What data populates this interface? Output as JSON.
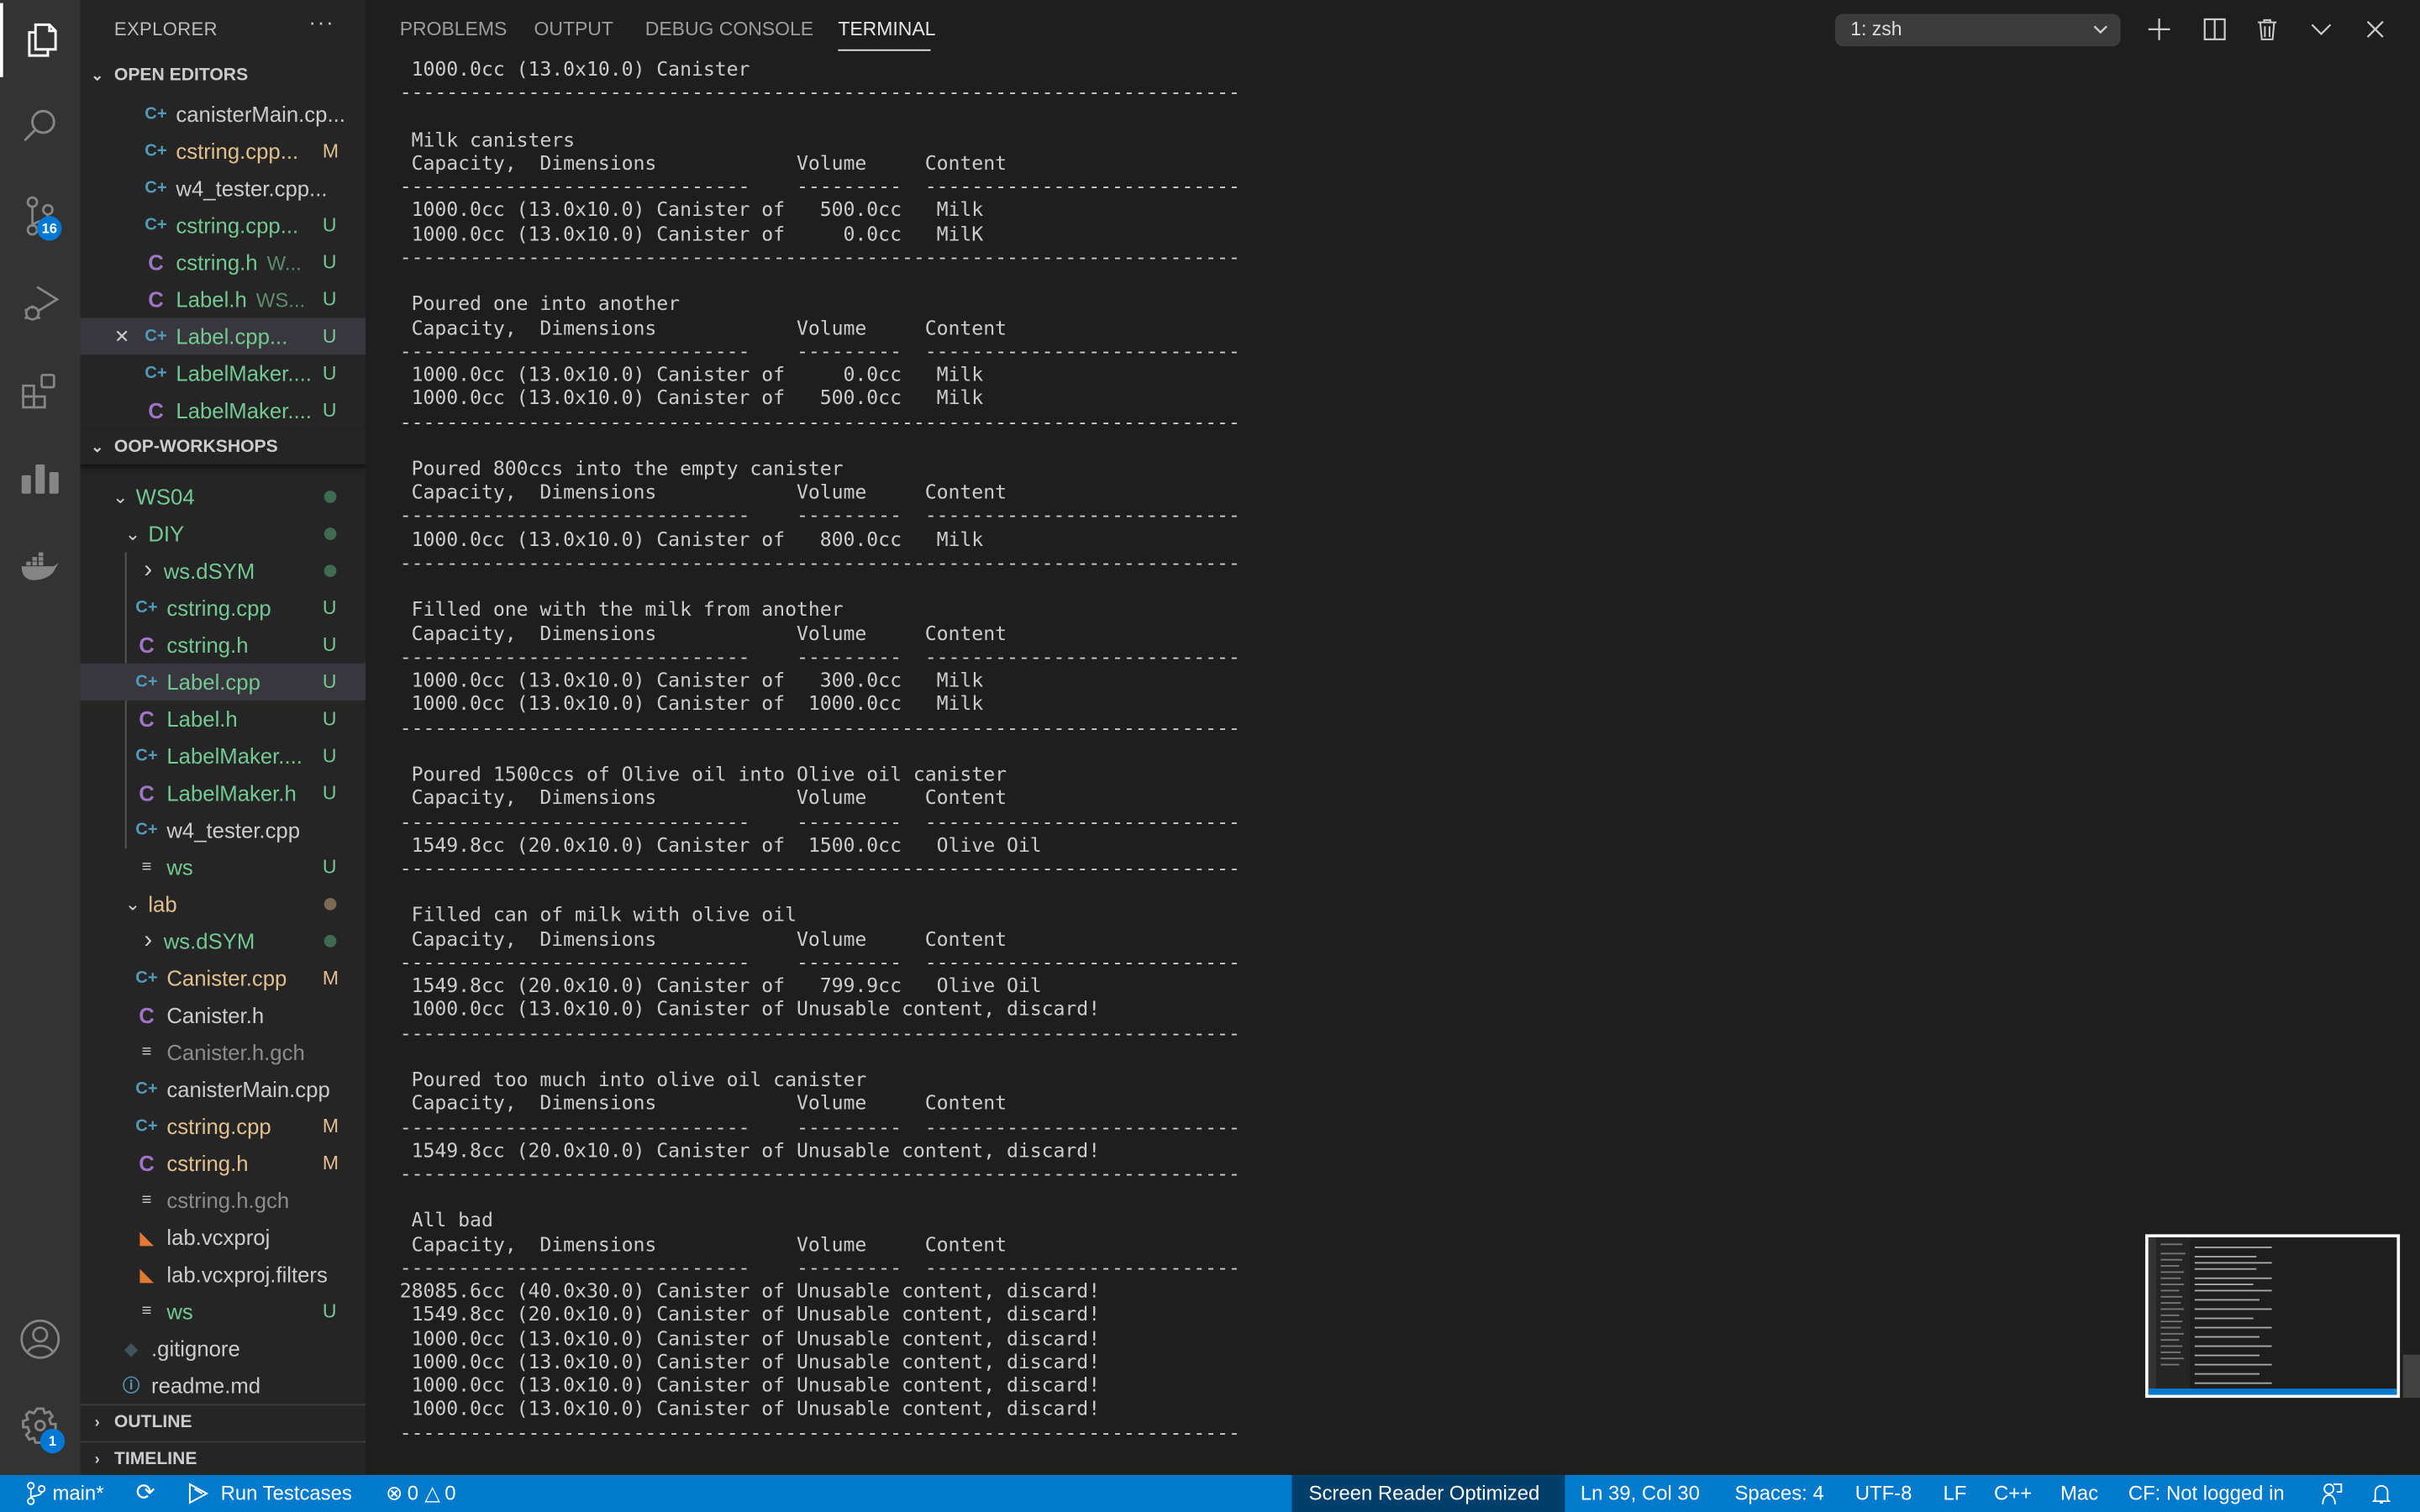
{
  "activity_bar": {
    "items": [
      {
        "name": "explorer",
        "icon": "files-icon",
        "active": true
      },
      {
        "name": "search",
        "icon": "search-icon"
      },
      {
        "name": "source-control",
        "icon": "source-control-icon",
        "badge": "16"
      },
      {
        "name": "run-debug",
        "icon": "run-debug-icon"
      },
      {
        "name": "extensions",
        "icon": "extensions-icon"
      },
      {
        "name": "analytics",
        "icon": "bar-chart-icon"
      },
      {
        "name": "docker",
        "icon": "docker-icon"
      }
    ],
    "bottom": [
      {
        "name": "accounts",
        "icon": "account-icon"
      },
      {
        "name": "manage",
        "icon": "gear-icon",
        "badge": "1"
      }
    ]
  },
  "sidebar": {
    "title": "EXPLORER",
    "more": "···",
    "open_editors": {
      "label": "OPEN EDITORS",
      "items": [
        {
          "name": "canisterMain.cp...",
          "icon": "cpp",
          "color": "white"
        },
        {
          "name": "cstring.cpp...",
          "icon": "cpp",
          "color": "yellow",
          "badge": "M"
        },
        {
          "name": "w4_tester.cpp...",
          "icon": "cpp",
          "color": "white"
        },
        {
          "name": "cstring.cpp...",
          "icon": "cpp",
          "color": "green",
          "badge": "U"
        },
        {
          "name": "cstring.h",
          "desc": "W...",
          "icon": "c",
          "color": "green",
          "badge": "U"
        },
        {
          "name": "Label.h",
          "desc": "WS...",
          "icon": "c",
          "color": "green",
          "badge": "U"
        },
        {
          "name": "Label.cpp...",
          "icon": "cpp",
          "color": "green",
          "badge": "U",
          "selected": true,
          "close": true
        },
        {
          "name": "LabelMaker....",
          "icon": "cpp",
          "color": "green",
          "badge": "U"
        },
        {
          "name": "LabelMaker....",
          "icon": "c",
          "color": "green",
          "badge": "U"
        }
      ]
    },
    "workspace": {
      "label": "OOP-WORKSHOPS",
      "items": [
        {
          "name": "WS04",
          "folder": true,
          "open": true,
          "level": 1,
          "color": "green",
          "dot": "#3f6b52"
        },
        {
          "name": "DIY",
          "folder": true,
          "open": true,
          "level": 2,
          "color": "green",
          "dot": "#3f6b52"
        },
        {
          "name": "ws.dSYM",
          "folder": true,
          "open": false,
          "level": 3,
          "color": "green",
          "dot": "#3f6b52"
        },
        {
          "name": "cstring.cpp",
          "icon": "cpp",
          "level": 3,
          "color": "green",
          "badge": "U"
        },
        {
          "name": "cstring.h",
          "icon": "c",
          "level": 3,
          "color": "green",
          "badge": "U"
        },
        {
          "name": "Label.cpp",
          "icon": "cpp",
          "level": 3,
          "color": "green",
          "badge": "U",
          "selected": true
        },
        {
          "name": "Label.h",
          "icon": "c",
          "level": 3,
          "color": "green",
          "badge": "U"
        },
        {
          "name": "LabelMaker....",
          "icon": "cpp",
          "level": 3,
          "color": "green",
          "badge": "U"
        },
        {
          "name": "LabelMaker.h",
          "icon": "c",
          "level": 3,
          "color": "green",
          "badge": "U"
        },
        {
          "name": "w4_tester.cpp",
          "icon": "cpp",
          "level": 3,
          "color": "white"
        },
        {
          "name": "ws",
          "icon": "txt",
          "level": 3,
          "color": "green",
          "badge": "U"
        },
        {
          "name": "lab",
          "folder": true,
          "open": true,
          "level": 2,
          "color": "yellow",
          "dot": "#7a6a52"
        },
        {
          "name": "ws.dSYM",
          "folder": true,
          "open": false,
          "level": 3,
          "color": "green",
          "dot": "#3f6b52"
        },
        {
          "name": "Canister.cpp",
          "icon": "cpp",
          "level": 3,
          "color": "yellow",
          "badge": "M"
        },
        {
          "name": "Canister.h",
          "icon": "c",
          "level": 3,
          "color": "white"
        },
        {
          "name": "Canister.h.gch",
          "icon": "txt",
          "level": 3,
          "color": "gray"
        },
        {
          "name": "canisterMain.cpp",
          "icon": "cpp",
          "level": 3,
          "color": "white"
        },
        {
          "name": "cstring.cpp",
          "icon": "cpp",
          "level": 3,
          "color": "yellow",
          "badge": "M"
        },
        {
          "name": "cstring.h",
          "icon": "c",
          "level": 3,
          "color": "yellow",
          "badge": "M"
        },
        {
          "name": "cstring.h.gch",
          "icon": "txt",
          "level": 3,
          "color": "gray"
        },
        {
          "name": "lab.vcxproj",
          "icon": "rss",
          "level": 3,
          "color": "white"
        },
        {
          "name": "lab.vcxproj.filters",
          "icon": "rss",
          "level": 3,
          "color": "white"
        },
        {
          "name": "ws",
          "icon": "txt",
          "level": 3,
          "color": "green",
          "badge": "U"
        },
        {
          "name": ".gitignore",
          "icon": "git",
          "level": 2,
          "color": "white"
        },
        {
          "name": "readme.md",
          "icon": "info",
          "level": 2,
          "color": "white"
        }
      ]
    },
    "outline_label": "OUTLINE",
    "timeline_label": "TIMELINE"
  },
  "panel": {
    "tabs": [
      {
        "label": "PROBLEMS"
      },
      {
        "label": "OUTPUT"
      },
      {
        "label": "DEBUG CONSOLE"
      },
      {
        "label": "TERMINAL",
        "active": true
      }
    ],
    "shell_select": "1: zsh",
    "toolbar": [
      "plus-icon",
      "split-icon",
      "trash-icon",
      "chevron-down-icon",
      "close-icon"
    ],
    "terminal_lines": [
      " 1000.0cc (13.0x10.0) Canister",
      "------------------------------------------------------------------------",
      "",
      " Milk canisters",
      " Capacity,  Dimensions            Volume     Content",
      "------------------------------    ---------  ---------------------------",
      " 1000.0cc (13.0x10.0) Canister of   500.0cc   Milk",
      " 1000.0cc (13.0x10.0) Canister of     0.0cc   MilK",
      "------------------------------------------------------------------------",
      "",
      " Poured one into another",
      " Capacity,  Dimensions            Volume     Content",
      "------------------------------    ---------  ---------------------------",
      " 1000.0cc (13.0x10.0) Canister of     0.0cc   Milk",
      " 1000.0cc (13.0x10.0) Canister of   500.0cc   Milk",
      "------------------------------------------------------------------------",
      "",
      " Poured 800ccs into the empty canister",
      " Capacity,  Dimensions            Volume     Content",
      "------------------------------    ---------  ---------------------------",
      " 1000.0cc (13.0x10.0) Canister of   800.0cc   Milk",
      "------------------------------------------------------------------------",
      "",
      " Filled one with the milk from another",
      " Capacity,  Dimensions            Volume     Content",
      "------------------------------    ---------  ---------------------------",
      " 1000.0cc (13.0x10.0) Canister of   300.0cc   Milk",
      " 1000.0cc (13.0x10.0) Canister of  1000.0cc   Milk",
      "------------------------------------------------------------------------",
      "",
      " Poured 1500ccs of Olive oil into Olive oil canister",
      " Capacity,  Dimensions            Volume     Content",
      "------------------------------    ---------  ---------------------------",
      " 1549.8cc (20.0x10.0) Canister of  1500.0cc   Olive Oil",
      "------------------------------------------------------------------------",
      "",
      " Filled can of milk with olive oil",
      " Capacity,  Dimensions            Volume     Content",
      "------------------------------    ---------  ---------------------------",
      " 1549.8cc (20.0x10.0) Canister of   799.9cc   Olive Oil",
      " 1000.0cc (13.0x10.0) Canister of Unusable content, discard!",
      "------------------------------------------------------------------------",
      "",
      " Poured too much into olive oil canister",
      " Capacity,  Dimensions            Volume     Content",
      "------------------------------    ---------  ---------------------------",
      " 1549.8cc (20.0x10.0) Canister of Unusable content, discard!",
      "------------------------------------------------------------------------",
      "",
      " All bad",
      " Capacity,  Dimensions            Volume     Content",
      "------------------------------    ---------  ---------------------------",
      "28085.6cc (40.0x30.0) Canister of Unusable content, discard!",
      " 1549.8cc (20.0x10.0) Canister of Unusable content, discard!",
      " 1000.0cc (13.0x10.0) Canister of Unusable content, discard!",
      " 1000.0cc (13.0x10.0) Canister of Unusable content, discard!",
      " 1000.0cc (13.0x10.0) Canister of Unusable content, discard!",
      " 1000.0cc (13.0x10.0) Canister of Unusable content, discard!",
      "------------------------------------------------------------------------"
    ]
  },
  "status_bar": {
    "branch": "main*",
    "run_testcases": "Run Testcases",
    "errors": "0",
    "warnings": "0",
    "screen_reader": "Screen Reader Optimized",
    "cursor": "Ln 39, Col 30",
    "spaces": "Spaces: 4",
    "encoding": "UTF-8",
    "eol": "LF",
    "language": "C++",
    "platform": "Mac",
    "cf_status": "CF: Not logged in"
  },
  "colors": {
    "accent": "#007acc",
    "untracked": "#73c991",
    "modified": "#e2c08d",
    "ignored": "#8c8c8c"
  }
}
